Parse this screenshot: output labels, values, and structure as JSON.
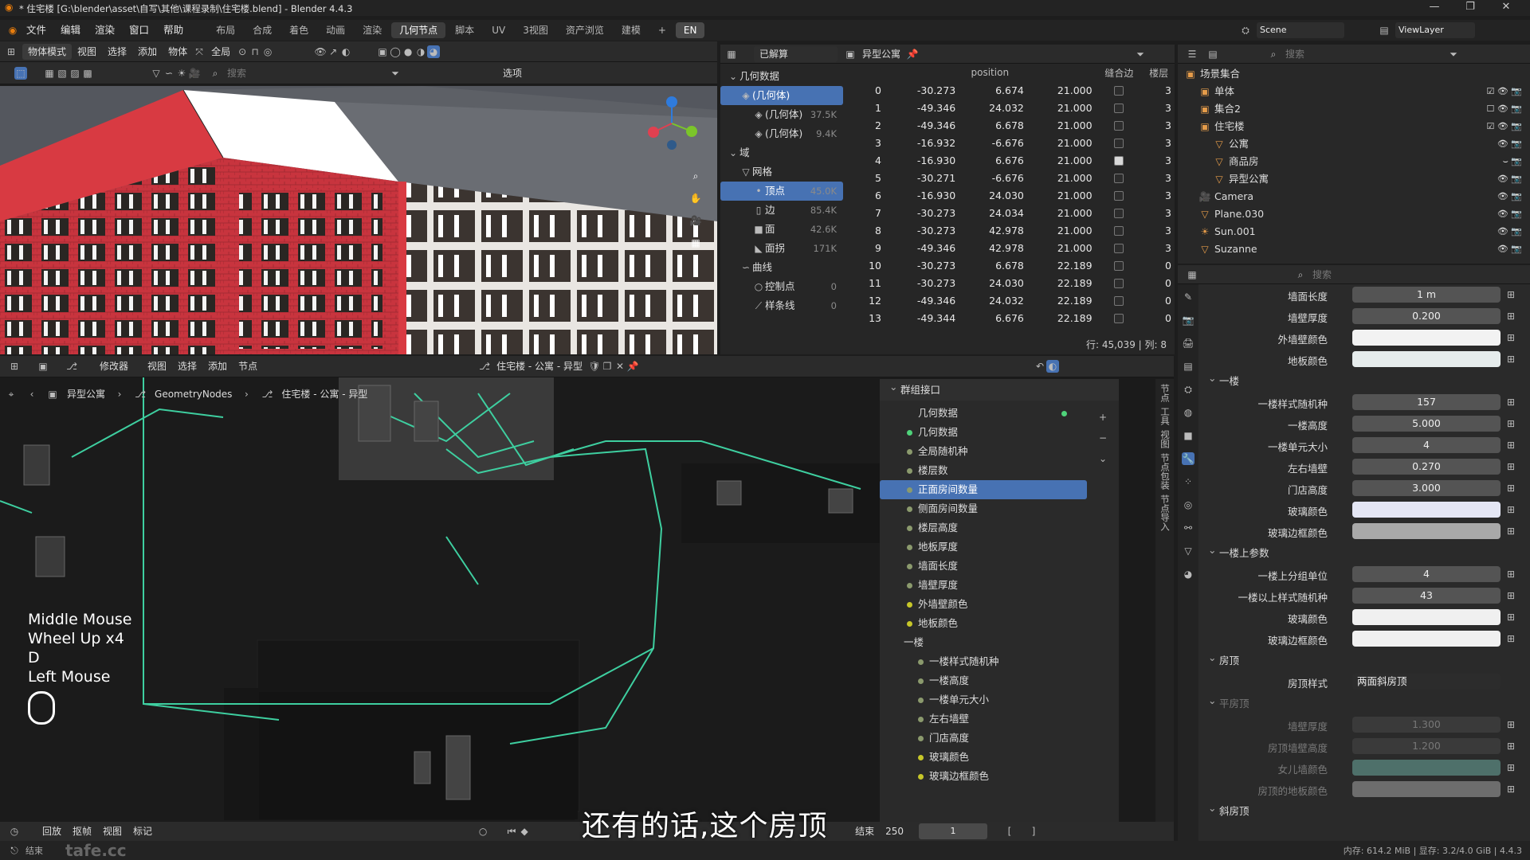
{
  "title_bar": {
    "title": "* 住宅楼 [G:\\blender\\asset\\自写\\其他\\课程录制\\住宅楼.blend] - Blender 4.4.3",
    "win_buttons": [
      "—",
      "❐",
      "✕"
    ]
  },
  "menu": [
    "文件",
    "编辑",
    "渲染",
    "窗口",
    "帮助"
  ],
  "workspaces": [
    "布局",
    "合成",
    "着色",
    "动画",
    "渲染",
    "几何节点",
    "脚本",
    "UV",
    "3视图",
    "资产浏览",
    "建模"
  ],
  "workspace_active": "几何节点",
  "lang_badge": "EN",
  "scene": {
    "scene_name": "Scene",
    "view_layer": "ViewLayer"
  },
  "viewport_header": {
    "mode": "物体模式",
    "menus": [
      "视图",
      "选择",
      "添加",
      "物体"
    ],
    "transform": "全局",
    "options": "选项",
    "search": "搜索"
  },
  "spreadsheet": {
    "header_left": "已解算",
    "object": "异型公寓",
    "tree": [
      {
        "label": "几何数据",
        "count": "",
        "level": 0,
        "sel": false,
        "icon": "⌄"
      },
      {
        "label": "(几何体)",
        "count": "",
        "level": 1,
        "sel": true,
        "icon": "◈"
      },
      {
        "label": "(几何体)",
        "count": "37.5K",
        "level": 2,
        "sel": false,
        "icon": "◈"
      },
      {
        "label": "(几何体)",
        "count": "9.4K",
        "level": 2,
        "sel": false,
        "icon": "◈"
      },
      {
        "label": "域",
        "count": "",
        "level": 0,
        "sel": false,
        "icon": "⌄"
      },
      {
        "label": "网格",
        "count": "",
        "level": 1,
        "sel": false,
        "icon": "▽"
      },
      {
        "label": "顶点",
        "count": "45.0K",
        "level": 2,
        "sel": true,
        "icon": "•"
      },
      {
        "label": "边",
        "count": "85.4K",
        "level": 2,
        "sel": false,
        "icon": "▯"
      },
      {
        "label": "面",
        "count": "42.6K",
        "level": 2,
        "sel": false,
        "icon": "■"
      },
      {
        "label": "面拐",
        "count": "171K",
        "level": 2,
        "sel": false,
        "icon": "◣"
      },
      {
        "label": "曲线",
        "count": "",
        "level": 1,
        "sel": false,
        "icon": "∽"
      },
      {
        "label": "控制点",
        "count": "0",
        "level": 2,
        "sel": false,
        "icon": "○"
      },
      {
        "label": "样条线",
        "count": "0",
        "level": 2,
        "sel": false,
        "icon": "⟋"
      }
    ],
    "columns": [
      "position",
      "缝合边",
      "楼层"
    ],
    "rows": [
      {
        "i": "0",
        "x": "-30.273",
        "y": "6.674",
        "z": "21.000",
        "seam": false,
        "floor": "3"
      },
      {
        "i": "1",
        "x": "-49.346",
        "y": "24.032",
        "z": "21.000",
        "seam": false,
        "floor": "3"
      },
      {
        "i": "2",
        "x": "-49.346",
        "y": "6.678",
        "z": "21.000",
        "seam": false,
        "floor": "3"
      },
      {
        "i": "3",
        "x": "-16.932",
        "y": "-6.676",
        "z": "21.000",
        "seam": false,
        "floor": "3"
      },
      {
        "i": "4",
        "x": "-16.930",
        "y": "6.676",
        "z": "21.000",
        "seam": true,
        "floor": "3"
      },
      {
        "i": "5",
        "x": "-30.271",
        "y": "-6.676",
        "z": "21.000",
        "seam": false,
        "floor": "3"
      },
      {
        "i": "6",
        "x": "-16.930",
        "y": "24.030",
        "z": "21.000",
        "seam": false,
        "floor": "3"
      },
      {
        "i": "7",
        "x": "-30.273",
        "y": "24.034",
        "z": "21.000",
        "seam": false,
        "floor": "3"
      },
      {
        "i": "8",
        "x": "-30.273",
        "y": "42.978",
        "z": "21.000",
        "seam": false,
        "floor": "3"
      },
      {
        "i": "9",
        "x": "-49.346",
        "y": "42.978",
        "z": "21.000",
        "seam": false,
        "floor": "3"
      },
      {
        "i": "10",
        "x": "-30.273",
        "y": "6.678",
        "z": "22.189",
        "seam": false,
        "floor": "0"
      },
      {
        "i": "11",
        "x": "-30.273",
        "y": "24.030",
        "z": "22.189",
        "seam": false,
        "floor": "0"
      },
      {
        "i": "12",
        "x": "-49.346",
        "y": "24.032",
        "z": "22.189",
        "seam": false,
        "floor": "0"
      },
      {
        "i": "13",
        "x": "-49.344",
        "y": "6.676",
        "z": "22.189",
        "seam": false,
        "floor": "0"
      }
    ],
    "footer": "行: 45,039  |  列: 8"
  },
  "outliner": {
    "search": "搜索",
    "items": [
      {
        "label": "场景集合",
        "level": 0,
        "icon": "▣",
        "vis": ""
      },
      {
        "label": "单体",
        "level": 1,
        "icon": "▣",
        "vis": "☑ 👁 📷"
      },
      {
        "label": "集合2",
        "level": 1,
        "icon": "▣",
        "vis": "☐ 👁 📷"
      },
      {
        "label": "住宅楼",
        "level": 1,
        "icon": "▣",
        "vis": "☑ 👁 📷"
      },
      {
        "label": "公寓",
        "level": 2,
        "icon": "▽",
        "vis": "👁 📷"
      },
      {
        "label": "商品房",
        "level": 2,
        "icon": "▽",
        "vis": "⌣ 📷"
      },
      {
        "label": "异型公寓",
        "level": 2,
        "icon": "▽",
        "vis": "👁 📷"
      },
      {
        "label": "Camera",
        "level": 1,
        "icon": "🎥",
        "vis": "👁 📷"
      },
      {
        "label": "Plane.030",
        "level": 1,
        "icon": "▽",
        "vis": "👁 📷"
      },
      {
        "label": "Sun.001",
        "level": 1,
        "icon": "☀",
        "vis": "👁 📷"
      },
      {
        "label": "Suzanne",
        "level": 1,
        "icon": "▽",
        "vis": "👁 📷"
      }
    ]
  },
  "properties": {
    "search": "搜索",
    "rows": [
      {
        "kind": "field",
        "label": "墙面长度",
        "value": "1 m"
      },
      {
        "kind": "field",
        "label": "墙壁厚度",
        "value": "0.200"
      },
      {
        "kind": "color",
        "label": "外墙壁颜色",
        "color": "#f2f2f2"
      },
      {
        "kind": "color",
        "label": "地板颜色",
        "color": "#e6ecec"
      },
      {
        "kind": "section",
        "label": "一楼"
      },
      {
        "kind": "field",
        "label": "一楼样式随机种",
        "value": "157"
      },
      {
        "kind": "field",
        "label": "一楼高度",
        "value": "5.000"
      },
      {
        "kind": "field",
        "label": "一楼单元大小",
        "value": "4"
      },
      {
        "kind": "field",
        "label": "左右墙壁",
        "value": "0.270"
      },
      {
        "kind": "field",
        "label": "门店高度",
        "value": "3.000"
      },
      {
        "kind": "color",
        "label": "玻璃颜色",
        "color": "#e4e6f4"
      },
      {
        "kind": "color",
        "label": "玻璃边框颜色",
        "color": "#a9a9a9"
      },
      {
        "kind": "section",
        "label": "一楼上参数"
      },
      {
        "kind": "field",
        "label": "一楼上分组单位",
        "value": "4"
      },
      {
        "kind": "field",
        "label": "一楼以上样式随机种",
        "value": "43"
      },
      {
        "kind": "color",
        "label": "玻璃颜色",
        "color": "#f0f0f0"
      },
      {
        "kind": "color",
        "label": "玻璃边框颜色",
        "color": "#f0f0f0"
      },
      {
        "kind": "section",
        "label": "房顶"
      },
      {
        "kind": "select",
        "label": "房顶样式",
        "value": "两面斜房顶"
      },
      {
        "kind": "section-dim",
        "label": "平房顶"
      },
      {
        "kind": "field-dim",
        "label": "墙壁厚度",
        "value": "1.300"
      },
      {
        "kind": "field-dim",
        "label": "房顶墙壁高度",
        "value": "1.200"
      },
      {
        "kind": "color-dim",
        "label": "女儿墙颜色",
        "color": "#5e8f86"
      },
      {
        "kind": "color-dim",
        "label": "房顶的地板颜色",
        "color": "#8a8a8a"
      },
      {
        "kind": "section",
        "label": "斜房顶"
      }
    ]
  },
  "node_editor": {
    "header_menus": [
      "修改器",
      "视图",
      "选择",
      "添加",
      "节点"
    ],
    "node_group": "住宅楼 - 公寓 - 异型",
    "breadcrumb": [
      "异型公寓",
      "GeometryNodes",
      "住宅楼 - 公寓 - 异型"
    ],
    "sidebar_title": "群组接口",
    "interface": [
      {
        "label": "几何数据",
        "color": "#4fd37a",
        "level": 0,
        "sel": false,
        "out": true
      },
      {
        "label": "几何数据",
        "color": "#4fd37a",
        "level": 0,
        "sel": false,
        "out": false
      },
      {
        "label": "全局随机种",
        "color": "#8b9a6d",
        "level": 0,
        "sel": false,
        "out": false
      },
      {
        "label": "楼层数",
        "color": "#8b9a6d",
        "level": 0,
        "sel": false,
        "out": false
      },
      {
        "label": "正面房间数量",
        "color": "#8b9a6d",
        "level": 0,
        "sel": true,
        "out": false
      },
      {
        "label": "侧面房间数量",
        "color": "#8b9a6d",
        "level": 0,
        "sel": false,
        "out": false
      },
      {
        "label": "楼层高度",
        "color": "#8b9a6d",
        "level": 0,
        "sel": false,
        "out": false
      },
      {
        "label": "地板厚度",
        "color": "#8b9a6d",
        "level": 0,
        "sel": false,
        "out": false
      },
      {
        "label": "墙面长度",
        "color": "#8b9a6d",
        "level": 0,
        "sel": false,
        "out": false
      },
      {
        "label": "墙壁厚度",
        "color": "#8b9a6d",
        "level": 0,
        "sel": false,
        "out": false
      },
      {
        "label": "外墙壁颜色",
        "color": "#c7c729",
        "level": 0,
        "sel": false,
        "out": false
      },
      {
        "label": "地板颜色",
        "color": "#c7c729",
        "level": 0,
        "sel": false,
        "out": false
      },
      {
        "label": "一楼",
        "color": "",
        "level": -1,
        "sel": false,
        "out": false
      },
      {
        "label": "一楼样式随机种",
        "color": "#8b9a6d",
        "level": 1,
        "sel": false,
        "out": false
      },
      {
        "label": "一楼高度",
        "color": "#8b9a6d",
        "level": 1,
        "sel": false,
        "out": false
      },
      {
        "label": "一楼单元大小",
        "color": "#8b9a6d",
        "level": 1,
        "sel": false,
        "out": false
      },
      {
        "label": "左右墙壁",
        "color": "#8b9a6d",
        "level": 1,
        "sel": false,
        "out": false
      },
      {
        "label": "门店高度",
        "color": "#8b9a6d",
        "level": 1,
        "sel": false,
        "out": false
      },
      {
        "label": "玻璃颜色",
        "color": "#c7c729",
        "level": 1,
        "sel": false,
        "out": false
      },
      {
        "label": "玻璃边框颜色",
        "color": "#c7c729",
        "level": 1,
        "sel": false,
        "out": false
      }
    ],
    "side_tabs": [
      "节点",
      "工具",
      "视图",
      "节点包装",
      "节点导入"
    ]
  },
  "timeline": {
    "menus": [
      "回放",
      "抠帧",
      "视图",
      "标记"
    ],
    "end_label": "结束",
    "end_value": "250",
    "current": "1"
  },
  "key_overlay": [
    "Middle Mouse",
    "Wheel Up x4",
    "D",
    "Left Mouse"
  ],
  "subtitle": "还有的话,这个房顶",
  "statusbar": {
    "left": "结束",
    "right": "内存: 614.2 MiB | 显存: 3.2/4.0 GiB | 4.4.3"
  },
  "watermark": "tafe.cc"
}
